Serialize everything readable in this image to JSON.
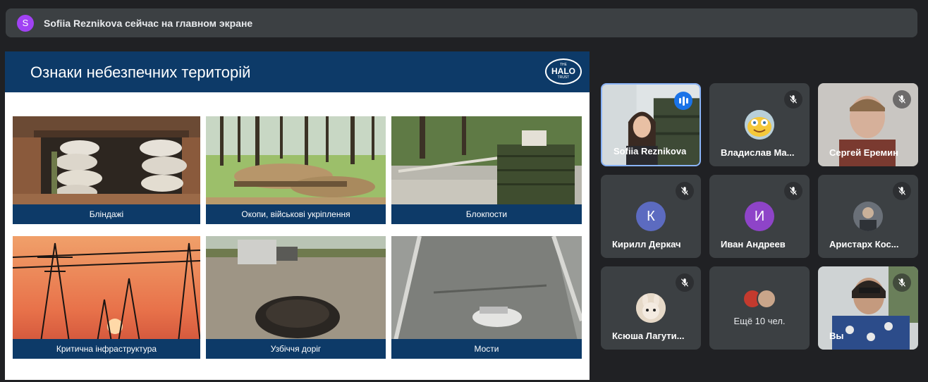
{
  "banner": {
    "avatar_letter": "S",
    "text": "Sofiia Reznikova сейчас на главном экране"
  },
  "slide": {
    "title": "Ознаки небезпечних територій",
    "logo": {
      "small_top": "THE",
      "word": "HALO",
      "small_bottom": "TRUST"
    },
    "tiles": [
      {
        "caption": "Бліндажі"
      },
      {
        "caption": "Окопи, військові укріплення"
      },
      {
        "caption": "Блокпости"
      },
      {
        "caption": "Критична інфраструктура"
      },
      {
        "caption": "Узбіччя доріг"
      },
      {
        "caption": "Мости"
      }
    ]
  },
  "participants": [
    {
      "name": "Sofiia Reznikova",
      "mic": "speaking"
    },
    {
      "name": "Владислав Ма...",
      "mic": "muted"
    },
    {
      "name": "Сергей Еремин",
      "mic": "muted"
    },
    {
      "name": "Кирилл Деркач",
      "mic": "muted",
      "avatar_letter": "К",
      "avatar_color": "#5c6bc0"
    },
    {
      "name": "Иван Андреев",
      "mic": "muted",
      "avatar_letter": "И",
      "avatar_color": "#8e44c8"
    },
    {
      "name": "Аристарх Кос...",
      "mic": "muted"
    },
    {
      "name": "Ксюша Лагути...",
      "mic": "muted"
    },
    {
      "more_label": "Ещё 10 чел."
    },
    {
      "name": "Вы",
      "mic": "muted"
    }
  ],
  "icons": {
    "mic_off": "mic-off-icon",
    "speaking": "audio-level-icon"
  }
}
